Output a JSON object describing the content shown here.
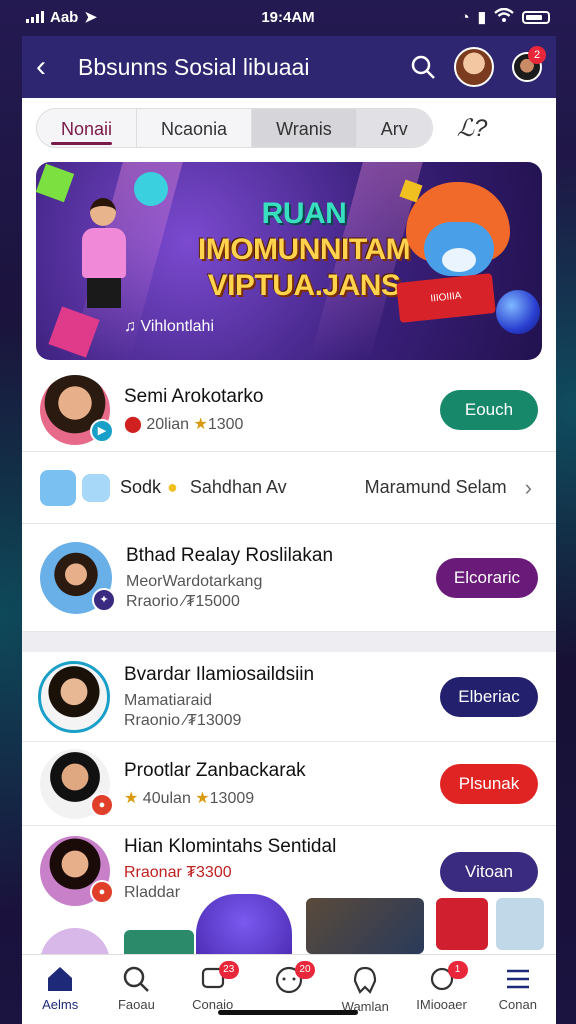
{
  "status": {
    "carrier": "Aab",
    "time": "19:4AM"
  },
  "header": {
    "title": "Bbsunns Sosial libuaai"
  },
  "tabs": [
    "Nonaii",
    "Ncaonia",
    "Wranis",
    "Arv"
  ],
  "banner": {
    "title_line1": "RUAN",
    "title_line2": "IMOMUNNITAM",
    "title_line3": "VIPTUA.JANS",
    "subtitle": "Vihlontlahi",
    "book_text": "IIIOIIIA"
  },
  "rows": [
    {
      "name": "Semi Arokotarko",
      "meta_a": "20lian",
      "meta_b": "1300",
      "button": "Eouch",
      "button_color": "#17886a"
    },
    {
      "type": "filter",
      "left": "Sodk",
      "middle": "Sahdhan Av",
      "right": "Maramund Selam"
    },
    {
      "name": "Bthad Realay Roslilakan",
      "line2": "MeorWardotarkang",
      "line3": "Rraorio ∕₮15000",
      "button": "Elcoraric",
      "button_color": "#6a1a78"
    },
    {
      "name": "Bvardar Ilamiosaildsiin",
      "line2": "Mamatiaraid",
      "line3": "Rraonio ∕₮13009",
      "button": "Elberiac",
      "button_color": "#23206e"
    },
    {
      "name": "Prootlar Zanbackarak",
      "meta_a": "40ulan",
      "meta_b": "13009",
      "button": "Plsunak",
      "button_color": "#e02424"
    },
    {
      "name": "Hian Klomintahs Sentidal",
      "line2": "Rraonar ₮3300",
      "line3": "Rladdar",
      "button": "Vitoan",
      "button_color": "#3a2a80"
    }
  ],
  "nav": [
    {
      "label": "Aelms",
      "badge": ""
    },
    {
      "label": "Faoau",
      "badge": ""
    },
    {
      "label": "Conaio",
      "badge": "23"
    },
    {
      "label": "",
      "badge": "20"
    },
    {
      "label": "Wamlan",
      "badge": ""
    },
    {
      "label": "IMiooaer",
      "badge": "1"
    },
    {
      "label": "Conan",
      "badge": ""
    }
  ],
  "header_badge": "2",
  "colors": {
    "header": "#2e2670",
    "accent": "#7a1a4a"
  }
}
